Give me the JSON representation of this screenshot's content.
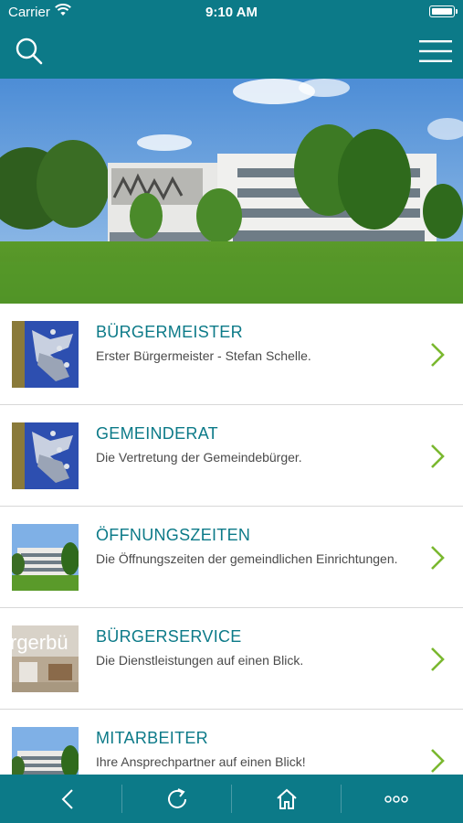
{
  "status_bar": {
    "carrier": "Carrier",
    "time": "9:10 AM"
  },
  "nav": {
    "search_icon": "search-icon",
    "menu_icon": "hamburger-menu-icon"
  },
  "colors": {
    "brand": "#0c7a88",
    "chevron": "#7ab82f",
    "title": "#0c7a88"
  },
  "list": [
    {
      "title": "BÜRGERMEISTER",
      "subtitle": "Erster Bürgermeister - Stefan Schelle.",
      "thumb": "sculpture"
    },
    {
      "title": "GEMEINDERAT",
      "subtitle": "Die Vertretung der Gemeindebürger.",
      "thumb": "sculpture"
    },
    {
      "title": "ÖFFNUNGSZEITEN",
      "subtitle": "Die Öffnungszeiten der gemeindlichen Einrichtungen.",
      "thumb": "building"
    },
    {
      "title": "BÜRGERSERVICE",
      "subtitle": "Die Dienstleistungen auf einen Blick.",
      "thumb": "lobby",
      "thumb_text": "rgerbü"
    },
    {
      "title": "MITARBEITER",
      "subtitle": "Ihre Ansprechpartner auf einen Blick!",
      "thumb": "building"
    }
  ],
  "tabbar": [
    "back-icon",
    "refresh-icon",
    "home-icon",
    "more-icon"
  ]
}
